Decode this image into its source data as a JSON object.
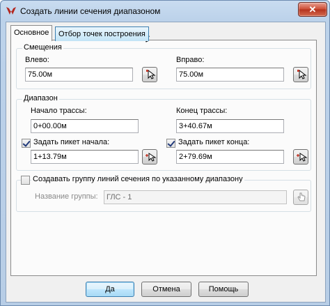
{
  "window": {
    "title": "Создать линии сечения диапазоном",
    "close_label": "✕"
  },
  "tabs": [
    {
      "label": "Основное",
      "active": true
    },
    {
      "label": "Отбор точек построения",
      "active": false
    }
  ],
  "offsets": {
    "legend": "Смещения",
    "left_label": "Влево:",
    "left_value": "75.00м",
    "right_label": "Вправо:",
    "right_value": "75.00м"
  },
  "range": {
    "legend": "Диапазон",
    "start_label": "Начало трассы:",
    "start_value": "0+00.00м",
    "end_label": "Конец трассы:",
    "end_value": "3+40.67м",
    "set_start_label": "Задать пикет начала:",
    "set_start_checked": true,
    "set_start_value": "1+13.79м",
    "set_end_label": "Задать пикет конца:",
    "set_end_checked": true,
    "set_end_value": "2+79.69м"
  },
  "group": {
    "checkbox_label": "Создавать группу линий сечения по указанному диапазону",
    "checked": false,
    "name_label": "Название группы:",
    "name_value": "ГЛС - 1"
  },
  "buttons": {
    "ok": "Да",
    "cancel": "Отмена",
    "help": "Помощь"
  }
}
